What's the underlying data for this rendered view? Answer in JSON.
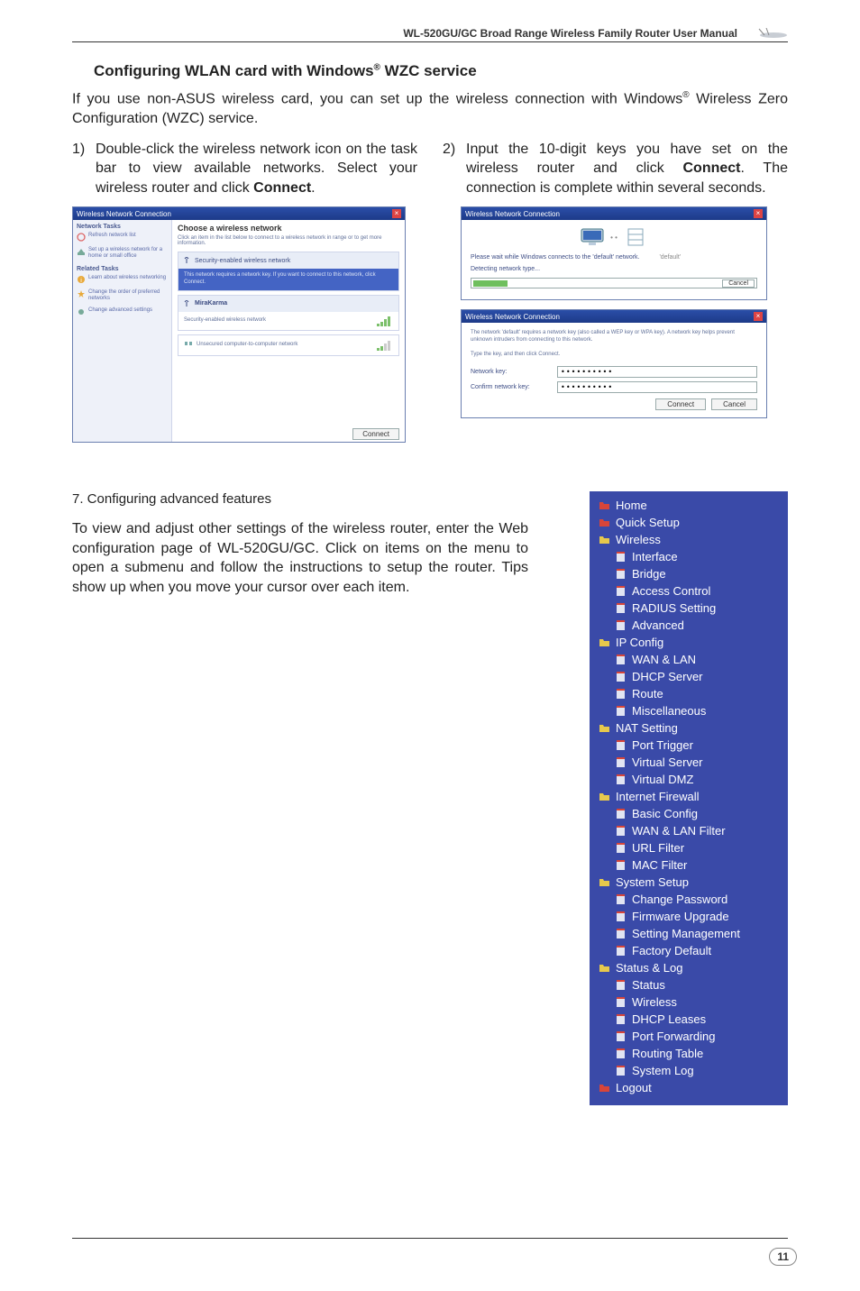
{
  "header": {
    "title": "WL-520GU/GC Broad Range Wireless Family Router User Manual"
  },
  "section": {
    "title_pre": "Configuring WLAN card with Windows",
    "title_post": " WZC service",
    "intro_pre": "If you use non-ASUS wireless card, you can set up the wireless connection with Windows",
    "intro_post": " Wireless Zero Configuration (WZC) service."
  },
  "steps": {
    "s1_num": "1)",
    "s1_a": "Double-click the wireless network icon on the task bar to view available networks. Select your wireless router and click ",
    "s1_b": "Connect",
    "s1_c": ".",
    "s2_num": "2)",
    "s2_a": "Input the 10-digit keys you have set on the wireless router and click ",
    "s2_b": "Connect",
    "s2_c": ". The connection is complete within several seconds."
  },
  "shot1": {
    "title": "Wireless Network Connection",
    "side_group1": "Network Tasks",
    "side_item1": "Refresh network list",
    "side_item2": "Set up a wireless network for a home or small office",
    "side_group2": "Related Tasks",
    "side_item3": "Learn about wireless networking",
    "side_item4": "Change the order of preferred networks",
    "side_item5": "Change advanced settings",
    "main_heading": "Choose a wireless network",
    "main_sub": "Click an item in the list below to connect to a wireless network in range or to get more information.",
    "net1_head": "Security-enabled wireless network",
    "net1_body": "This network requires a network key. If you want to connect to this network, click Connect.",
    "net2_name": "MiraKarma",
    "net2_sub": "Security-enabled wireless network",
    "net3_sub": "Unsecured computer-to-computer network",
    "btn": "Connect"
  },
  "shot2": {
    "title1": "Wireless Network Connection",
    "line1": "Please wait while Windows connects to the 'default' network.",
    "line2": "Detecting network type...",
    "cancel": "Cancel",
    "title2": "Wireless Network Connection",
    "desc": "The network 'default' requires a network key (also called a WEP key or WPA key). A network key helps prevent unknown intruders from connecting to this network.",
    "desc2": "Type the key, and then click Connect.",
    "label1": "Network key:",
    "label2": "Confirm network key:",
    "value": "••••••••••",
    "btn_connect": "Connect",
    "btn_cancel": "Cancel"
  },
  "sec7": {
    "heading": "7.  Configuring advanced features",
    "body": "To view and adjust other settings of the wireless router, enter the Web configuration page of WL-520GU/GC. Click on items on the menu to open a submenu and follow the instructions to setup the router. Tips show up when you move your cursor over each item."
  },
  "menu": [
    {
      "label": "Home",
      "type": "top",
      "color": "#d8453a"
    },
    {
      "label": "Quick Setup",
      "type": "top",
      "color": "#d8453a"
    },
    {
      "label": "Wireless",
      "type": "top",
      "color": "#e6c84c"
    },
    {
      "label": "Interface",
      "type": "sub"
    },
    {
      "label": "Bridge",
      "type": "sub"
    },
    {
      "label": "Access Control",
      "type": "sub"
    },
    {
      "label": "RADIUS Setting",
      "type": "sub"
    },
    {
      "label": "Advanced",
      "type": "sub"
    },
    {
      "label": "IP Config",
      "type": "top",
      "color": "#e6c84c"
    },
    {
      "label": "WAN & LAN",
      "type": "sub"
    },
    {
      "label": "DHCP Server",
      "type": "sub"
    },
    {
      "label": "Route",
      "type": "sub"
    },
    {
      "label": "Miscellaneous",
      "type": "sub"
    },
    {
      "label": "NAT Setting",
      "type": "top",
      "color": "#e6c84c"
    },
    {
      "label": "Port Trigger",
      "type": "sub"
    },
    {
      "label": "Virtual Server",
      "type": "sub"
    },
    {
      "label": "Virtual DMZ",
      "type": "sub"
    },
    {
      "label": "Internet Firewall",
      "type": "top",
      "color": "#e6c84c"
    },
    {
      "label": "Basic Config",
      "type": "sub"
    },
    {
      "label": "WAN & LAN Filter",
      "type": "sub"
    },
    {
      "label": "URL Filter",
      "type": "sub"
    },
    {
      "label": "MAC Filter",
      "type": "sub"
    },
    {
      "label": "System Setup",
      "type": "top",
      "color": "#e6c84c"
    },
    {
      "label": "Change Password",
      "type": "sub"
    },
    {
      "label": "Firmware Upgrade",
      "type": "sub"
    },
    {
      "label": "Setting Management",
      "type": "sub"
    },
    {
      "label": "Factory Default",
      "type": "sub"
    },
    {
      "label": "Status & Log",
      "type": "top",
      "color": "#e6c84c"
    },
    {
      "label": "Status",
      "type": "sub"
    },
    {
      "label": "Wireless",
      "type": "sub"
    },
    {
      "label": "DHCP Leases",
      "type": "sub"
    },
    {
      "label": "Port Forwarding",
      "type": "sub"
    },
    {
      "label": "Routing Table",
      "type": "sub"
    },
    {
      "label": "System Log",
      "type": "sub"
    },
    {
      "label": "Logout",
      "type": "top",
      "color": "#d8453a"
    }
  ],
  "page_number": "11"
}
